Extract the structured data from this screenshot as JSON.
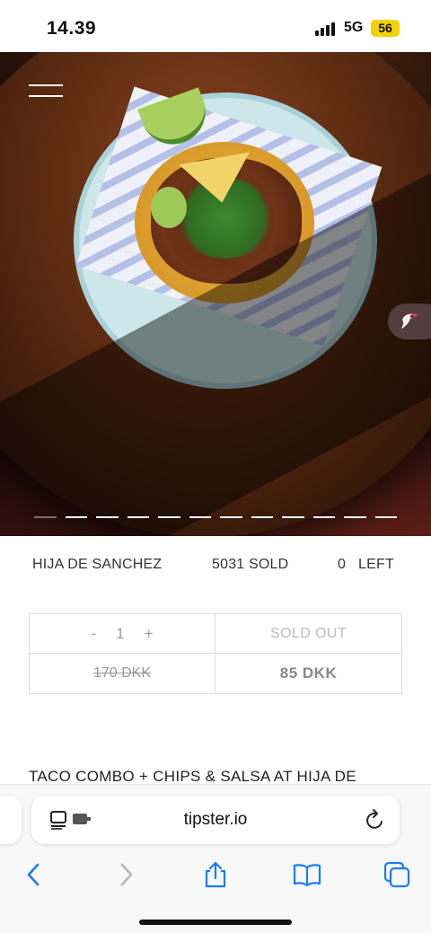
{
  "status_bar": {
    "time": "14.39",
    "network": "5G",
    "battery": "56"
  },
  "hero": {
    "slide_count": 12,
    "active_slide": 1
  },
  "product": {
    "vendor": "HIJA DE SANCHEZ",
    "sold": "5031 SOLD",
    "left": "0   LEFT",
    "quantity": {
      "minus": "-",
      "value": "1",
      "plus": "+"
    },
    "status": "SOLD OUT",
    "original_price": "170 DKK",
    "price": "85 DKK",
    "title": "TACO COMBO + CHIPS & SALSA AT HIJA DE"
  },
  "browser": {
    "url": "tipster.io"
  },
  "icons": [
    "menu-icon",
    "tipster-bird-icon",
    "page-settings-icon",
    "reload-icon",
    "back-icon",
    "forward-icon",
    "share-icon",
    "bookmarks-icon",
    "tabs-icon"
  ],
  "colors": {
    "battery": "#f2d200",
    "browser_blue": "#1a7cf5",
    "price_text": "#888888"
  }
}
